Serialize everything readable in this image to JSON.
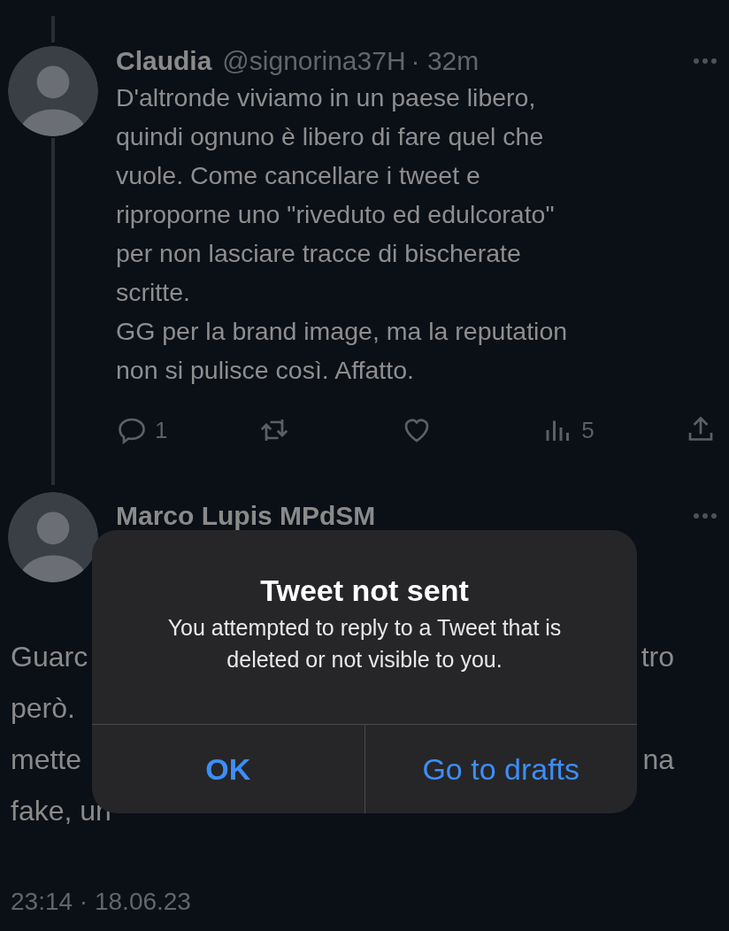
{
  "tweets": [
    {
      "name": "Claudia",
      "handle": "@signorina37H",
      "time": "· 32m",
      "lines": [
        "D'altronde viviamo in un paese libero,",
        "quindi ognuno è libero di fare quel che",
        "vuole. Come cancellare i tweet e",
        "riproporne uno \"riveduto ed edulcorato\"",
        "per non lasciare tracce di bischerate",
        "scritte.",
        "GG per la brand image, ma la reputation",
        "non si pulisce così. Affatto."
      ],
      "actions": [
        {
          "kind": "reply",
          "count": "1"
        },
        {
          "kind": "retweet"
        },
        {
          "kind": "like"
        },
        {
          "kind": "views",
          "count": "5"
        },
        {
          "kind": "share"
        }
      ]
    },
    {
      "name": "Marco Lupis MPdSM",
      "body_lines": [
        {
          "left": "Guarc",
          "right": "tro"
        },
        {
          "left": "però."
        },
        {
          "left": "mette",
          "right": "na"
        },
        {
          "left": "fake, un"
        }
      ],
      "timestamp": "23:14 · 18.06.23"
    }
  ],
  "dialog": {
    "title": "Tweet not sent",
    "message": "You attempted to reply to a Tweet that is deleted or not visible to you.",
    "buttons": [
      {
        "label": "OK",
        "kind": "default"
      },
      {
        "label": "Go to drafts",
        "kind": "normal"
      }
    ]
  }
}
